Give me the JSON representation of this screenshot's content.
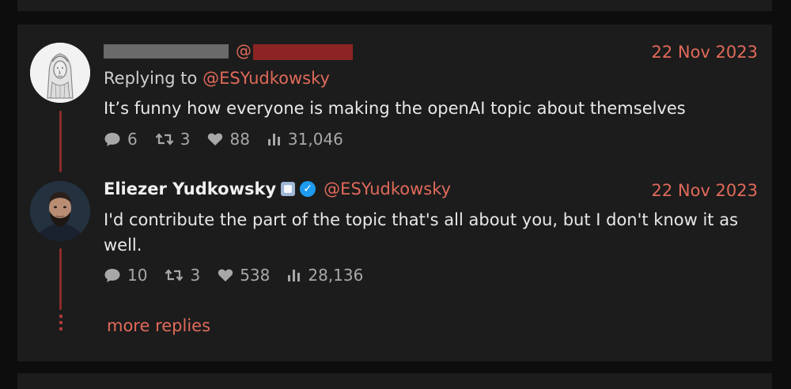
{
  "tweet1": {
    "date": "22 Nov 2023",
    "at_prefix": "@",
    "replying_prefix": "Replying to ",
    "replying_handle": "@ESYudkowsky",
    "text": "It’s funny how everyone is making the openAI topic about themselves",
    "stats": {
      "replies": "6",
      "retweets": "3",
      "likes": "88",
      "views": "31,046"
    }
  },
  "tweet2": {
    "author_name": "Eliezer Yudkowsky",
    "author_handle": "@ESYudkowsky",
    "date": "22 Nov 2023",
    "text": "I'd contribute the part of the topic that's all about you, but I don't know it as well.",
    "stats": {
      "replies": "10",
      "retweets": "3",
      "likes": "538",
      "views": "28,136"
    }
  },
  "more_replies": "more replies",
  "icons": {
    "reply": "comment-icon",
    "retweet": "retweet-icon",
    "like": "heart-icon",
    "views": "bar-chart-icon",
    "verified": "verified-check-icon",
    "badge": "affiliation-badge-icon"
  },
  "colors": {
    "accent": "#e06a5a",
    "thread_line": "#8b2c2c",
    "card_bg": "#1c1c1c",
    "page_bg": "#0d0d0d",
    "verified": "#1d9bf0"
  }
}
